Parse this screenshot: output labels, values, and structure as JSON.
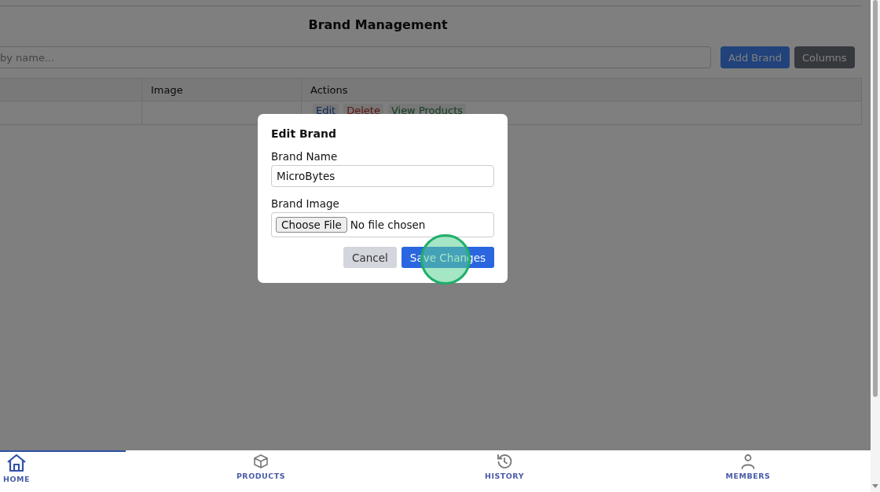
{
  "page": {
    "title": "Brand Management"
  },
  "search": {
    "placeholder": "by name..."
  },
  "toolbar_buttons": [
    {
      "label": "Add Brand",
      "kind": "primary"
    },
    {
      "label": "Columns",
      "kind": "secondary"
    }
  ],
  "table": {
    "columns": [
      "",
      "Image",
      "Actions"
    ],
    "rows": [
      {
        "actions": [
          {
            "label": "Edit",
            "kind": "edit"
          },
          {
            "label": "Delete",
            "kind": "delete"
          },
          {
            "label": "View Products",
            "kind": "view"
          }
        ]
      }
    ]
  },
  "dialog": {
    "title": "Edit Brand",
    "name_label": "Brand Name",
    "name_value": "MicroBytes",
    "image_label": "Brand Image",
    "file_button": "Choose File",
    "file_status": "No file chosen",
    "buttons": [
      {
        "label": "Cancel",
        "kind": "secondary"
      },
      {
        "label": "Save Changes",
        "kind": "primary"
      }
    ]
  },
  "bottom_nav": [
    {
      "label": "HOME",
      "kind": "home",
      "selected": true
    },
    {
      "label": "PRODUCTS",
      "kind": "box",
      "selected": false
    },
    {
      "label": "HISTORY",
      "kind": "history",
      "selected": false
    },
    {
      "label": "MEMBERS",
      "kind": "person",
      "selected": false
    }
  ]
}
